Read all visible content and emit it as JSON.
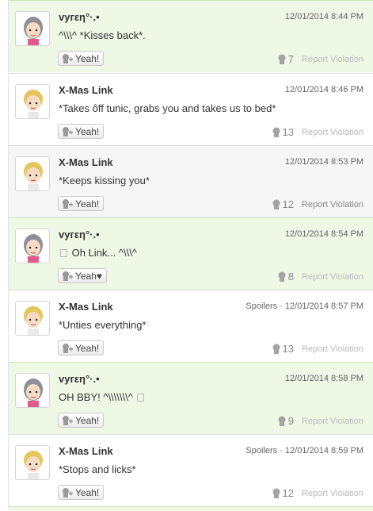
{
  "yeah_label": "Yeah!",
  "report_label": "Report Violation",
  "posts": [
    {
      "name": "vyгεη°·.•",
      "timestamp": "12/01/2014 8:44 PM",
      "text": "^\\\\\\^ *Kisses back*.",
      "yeah_label": "Yeah!",
      "yeah_count": "7"
    },
    {
      "name": "X-Mas Link",
      "timestamp": "12/01/2014 8:46 PM",
      "text": "*Takes ôff tunic, grabs you and takes us to bed*",
      "yeah_label": "Yeah!",
      "yeah_count": "13"
    },
    {
      "name": "X-Mas Link",
      "timestamp": "12/01/2014 8:53 PM",
      "text": "*Keeps kissing you*",
      "yeah_label": "Yeah!",
      "yeah_count": "12"
    },
    {
      "name": "vyгεη°·.•",
      "timestamp": "12/01/2014 8:54 PM",
      "text": "Oh Link... ^\\\\\\^",
      "yeah_label": "Yeah♥",
      "yeah_count": "8"
    },
    {
      "name": "X-Mas Link",
      "timestamp": "Spoilers · 12/01/2014 8:57 PM",
      "text": "*Unties everything*",
      "yeah_label": "Yeah!",
      "yeah_count": "13"
    },
    {
      "name": "vyгεη°·.•",
      "timestamp": "12/01/2014 8:58 PM",
      "text": "OH BBY! ^\\\\\\\\\\\\\\^",
      "yeah_label": "Yeah!",
      "yeah_count": "9"
    },
    {
      "name": "X-Mas Link",
      "timestamp": "Spoilers · 12/01/2014 8:59 PM",
      "text": "*Stops and licks*",
      "yeah_label": "Yeah!",
      "yeah_count": "12"
    }
  ],
  "colors": {
    "green_bg": "#eef8e4",
    "gray_bg": "#f6f6f6",
    "text": "#333333",
    "muted": "#888888"
  }
}
